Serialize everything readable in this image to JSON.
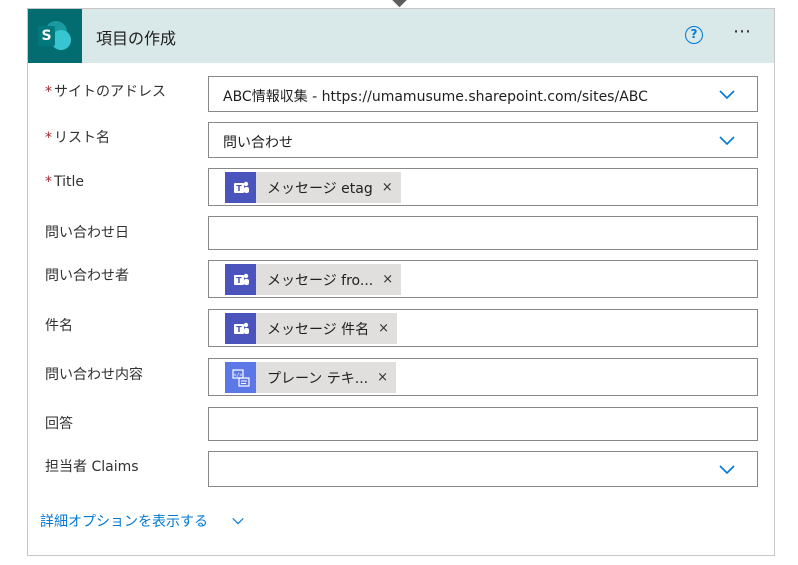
{
  "header": {
    "title": "項目の作成",
    "help_icon_text": "?",
    "more_text": "⋯"
  },
  "fields": {
    "site": {
      "required_mark": "*",
      "label": "サイトのアドレス",
      "value": "ABC情報収集 - https://umamusume.sharepoint.com/sites/ABC"
    },
    "list": {
      "required_mark": "*",
      "label": "リスト名",
      "value": "問い合わせ"
    },
    "title": {
      "required_mark": "*",
      "label": "Title",
      "token_label": "メッセージ etag",
      "token_close": "×",
      "token_icon": "teams-icon"
    },
    "date": {
      "label": "問い合わせ日",
      "value": ""
    },
    "sender": {
      "label": "問い合わせ者",
      "token_label": "メッセージ fro...",
      "token_close": "×",
      "token_icon": "teams-icon"
    },
    "subject": {
      "label": "件名",
      "token_label": "メッセージ 件名",
      "token_close": "×",
      "token_icon": "teams-icon"
    },
    "content": {
      "label": "問い合わせ内容",
      "token_label": "プレーン テキ...",
      "token_close": "×",
      "token_icon": "html-to-text-icon"
    },
    "answer": {
      "label": "回答",
      "value": ""
    },
    "owner": {
      "label": "担当者 Claims",
      "value": ""
    }
  },
  "advanced": {
    "label": "詳細オプションを表示する"
  },
  "colors": {
    "header_bg": "#d9e8e8",
    "sharepoint": "#036c70",
    "teams": "#4b53bc",
    "link": "#0078d4",
    "required": "#a4262c"
  }
}
